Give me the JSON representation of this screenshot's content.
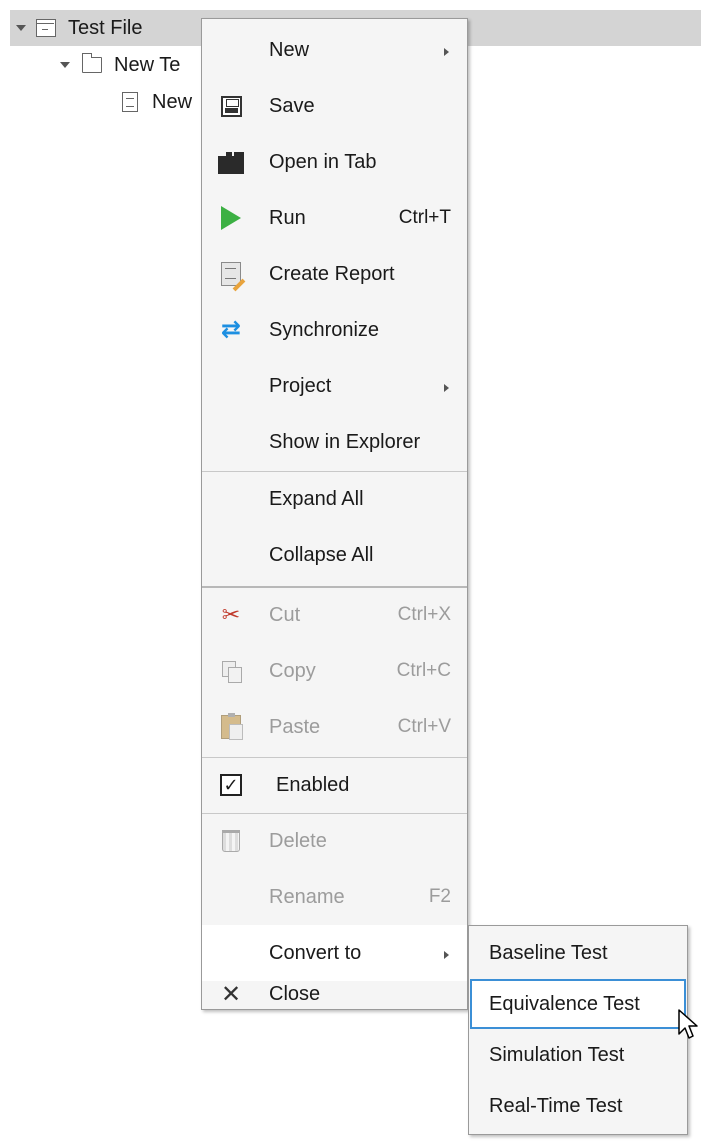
{
  "tree": {
    "root_label": "Test File",
    "suite_label": "New Te",
    "case_label": "New"
  },
  "menu": {
    "items": [
      {
        "label": "New",
        "shortcut": "",
        "icon": "none",
        "submenu": true
      },
      {
        "label": "Save",
        "shortcut": "",
        "icon": "save-icon"
      },
      {
        "label": "Open in Tab",
        "shortcut": "",
        "icon": "tab-icon"
      },
      {
        "label": "Run",
        "shortcut": "Ctrl+T",
        "icon": "run-icon"
      },
      {
        "label": "Create Report",
        "shortcut": "",
        "icon": "report-icon"
      },
      {
        "label": "Synchronize",
        "shortcut": "",
        "icon": "sync-icon"
      },
      {
        "label": "Project",
        "shortcut": "",
        "icon": "none",
        "submenu": true
      },
      {
        "label": "Show in Explorer",
        "shortcut": "",
        "icon": "none"
      },
      {
        "label": "Expand All",
        "shortcut": "",
        "icon": "none"
      },
      {
        "label": "Collapse All",
        "shortcut": "",
        "icon": "none"
      },
      {
        "label": "Cut",
        "shortcut": "Ctrl+X",
        "icon": "scissors-icon",
        "disabled": true
      },
      {
        "label": "Copy",
        "shortcut": "Ctrl+C",
        "icon": "copy-icon",
        "disabled": true
      },
      {
        "label": "Paste",
        "shortcut": "Ctrl+V",
        "icon": "paste-icon",
        "disabled": true
      },
      {
        "label": "Enabled",
        "shortcut": "",
        "icon": "checkbox-icon",
        "checked": true
      },
      {
        "label": "Delete",
        "shortcut": "",
        "icon": "trash-icon",
        "disabled": true
      },
      {
        "label": "Rename",
        "shortcut": "F2",
        "icon": "none",
        "disabled": true
      },
      {
        "label": "Convert to",
        "shortcut": "",
        "icon": "none",
        "submenu": true,
        "highlighted": true
      },
      {
        "label": "Close",
        "shortcut": "",
        "icon": "close-icon"
      }
    ]
  },
  "submenu": {
    "items": [
      {
        "label": "Baseline Test"
      },
      {
        "label": "Equivalence Test",
        "active": true
      },
      {
        "label": "Simulation Test"
      },
      {
        "label": "Real-Time Test"
      }
    ]
  },
  "colors": {
    "selection": "#d4d4d4",
    "menu_bg": "#f5f5f5",
    "focus_outline": "#3b8fd6",
    "run_green": "#3cb043",
    "sync_blue": "#1d8fe1"
  }
}
